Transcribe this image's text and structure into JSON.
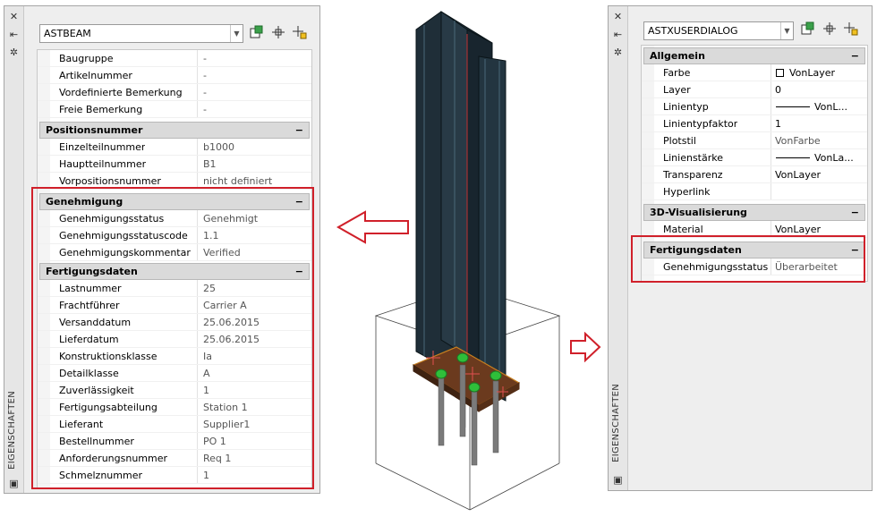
{
  "left_panel": {
    "palette_title": "EIGENSCHAFTEN",
    "object_type": "ASTBEAM",
    "top_rows": [
      {
        "label": "Baugruppe",
        "value": "-"
      },
      {
        "label": "Artikelnummer",
        "value": "-"
      },
      {
        "label": "Vordefinierte Bemerkung",
        "value": "-"
      },
      {
        "label": "Freie Bemerkung",
        "value": "-"
      }
    ],
    "positionsnummer": {
      "title": "Positionsnummer",
      "toggle": "−",
      "rows": [
        {
          "label": "Einzelteilnummer",
          "value": "b1000"
        },
        {
          "label": "Hauptteilnummer",
          "value": "B1"
        },
        {
          "label": "Vorpositionsnummer",
          "value": "nicht definiert"
        }
      ]
    },
    "genehmigung": {
      "title": "Genehmigung",
      "toggle": "−",
      "rows": [
        {
          "label": "Genehmigungsstatus",
          "value": "Genehmigt"
        },
        {
          "label": "Genehmigungsstatuscode",
          "value": "1.1"
        },
        {
          "label": "Genehmigungskommentar",
          "value": "Verified"
        }
      ]
    },
    "fertigungsdaten": {
      "title": "Fertigungsdaten",
      "toggle": "−",
      "rows": [
        {
          "label": "Lastnummer",
          "value": "25"
        },
        {
          "label": "Frachtführer",
          "value": "Carrier A"
        },
        {
          "label": "Versanddatum",
          "value": "25.06.2015"
        },
        {
          "label": "Lieferdatum",
          "value": "25.06.2015"
        },
        {
          "label": "Konstruktionsklasse",
          "value": "Ia"
        },
        {
          "label": "Detailklasse",
          "value": "A"
        },
        {
          "label": "Zuverlässigkeit",
          "value": "1"
        },
        {
          "label": "Fertigungsabteilung",
          "value": "Station 1"
        },
        {
          "label": "Lieferant",
          "value": "Supplier1"
        },
        {
          "label": "Bestellnummer",
          "value": "PO 1"
        },
        {
          "label": "Anforderungsnummer",
          "value": "Req 1"
        },
        {
          "label": "Schmelznummer",
          "value": "1"
        }
      ]
    }
  },
  "right_panel": {
    "palette_title": "EIGENSCHAFTEN",
    "object_type": "ASTXUSERDIALOG",
    "allgemein": {
      "title": "Allgemein",
      "toggle": "−",
      "rows": [
        {
          "label": "Farbe",
          "value": "VonLayer"
        },
        {
          "label": "Layer",
          "value": "0"
        },
        {
          "label": "Linientyp",
          "value": "VonL..."
        },
        {
          "label": "Linientypfaktor",
          "value": "1"
        },
        {
          "label": "Plotstil",
          "value": "VonFarbe"
        },
        {
          "label": "Linienstärke",
          "value": "VonLa..."
        },
        {
          "label": "Transparenz",
          "value": "VonLayer"
        },
        {
          "label": "Hyperlink",
          "value": ""
        }
      ]
    },
    "visualisierung": {
      "title": "3D-Visualisierung",
      "toggle": "−",
      "rows": [
        {
          "label": "Material",
          "value": "VonLayer"
        }
      ]
    },
    "fertigungsdaten": {
      "title": "Fertigungsdaten",
      "toggle": "−",
      "rows": [
        {
          "label": "Genehmigungsstatus",
          "value": "Überarbeitet"
        }
      ]
    }
  },
  "colors": {
    "highlight": "#d0202a",
    "beam": "#1f2e38",
    "plate": "#6b3a1e",
    "bolt": "#7a7a7a",
    "bolt_head": "#2fbf3a"
  },
  "icons": {
    "close": "close-icon",
    "autohide": "autohide-icon",
    "settings": "gear-icon",
    "quick_select": "quick-select-icon",
    "select_objects": "select-objects-icon",
    "toggle_pickadd": "pickadd-icon",
    "palette_menu": "palette-menu-icon"
  }
}
